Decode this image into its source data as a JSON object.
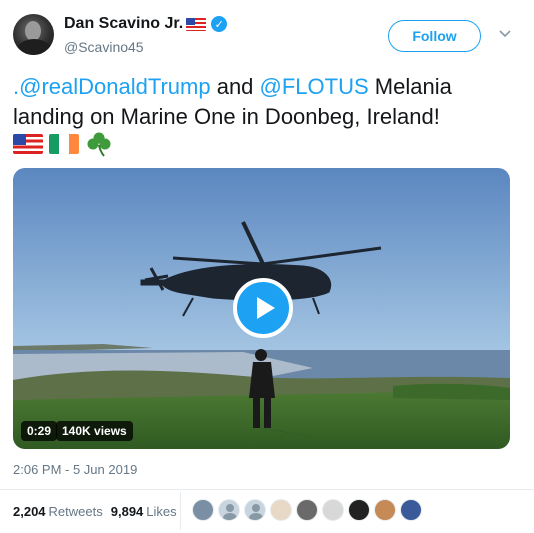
{
  "author": {
    "display_name": "Dan Scavino Jr.",
    "handle": "@Scavino45",
    "verified": true
  },
  "follow_label": "Follow",
  "tweet": {
    "mention1": ".@realDonaldTrump",
    "text1": " and ",
    "mention2": "@FLOTUS",
    "text2": " Melania landing on Marine One in Doonbeg, Ireland!",
    "emojis": [
      "us-flag-emoji",
      "ireland-flag-emoji",
      "shamrock-emoji"
    ]
  },
  "video": {
    "duration": "0:29",
    "views": "140K views"
  },
  "timestamp": "2:06 PM - 5 Jun 2019",
  "stats": {
    "retweets_count": "2,204",
    "retweets_label": "Retweets",
    "likes_count": "9,894",
    "likes_label": "Likes"
  },
  "colors": {
    "accent": "#1da1f2",
    "text": "#14171a",
    "secondary": "#657786"
  }
}
